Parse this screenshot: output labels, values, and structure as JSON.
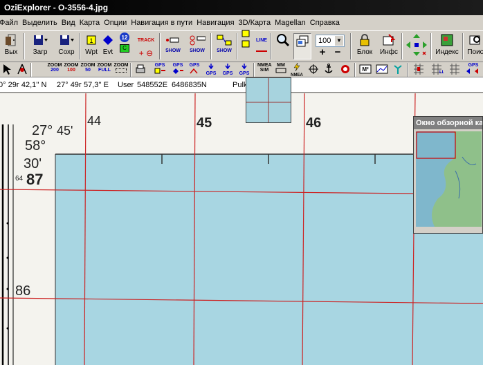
{
  "window": {
    "title": "OziExplorer - O-3556-4.jpg"
  },
  "menu": [
    "Файл",
    "Выделить",
    "Вид",
    "Карта",
    "Опции",
    "Навигация в пути",
    "Навигация",
    "3D/Карта",
    "Magellan",
    "Справка"
  ],
  "toolbar": {
    "exit": "Вых",
    "load": "Загр",
    "save": "Сохр",
    "wpt": "Wpt",
    "evt": "Evt",
    "track": "TRACK",
    "route_num": "12",
    "show1": "SHOW",
    "show2": "SHOW",
    "show3": "SHOW",
    "line": "LINE",
    "zoom_value": "100",
    "block": "Блок",
    "info": "Инфс",
    "index": "Индекс",
    "search": "Поис"
  },
  "toolbar2": {
    "zoom200": "200",
    "zoom100": "100",
    "zoom50": "50",
    "zoomfull": "FULL",
    "zoom_label": "ZOOM",
    "gps": "GPS",
    "nmea_sim": "SIM",
    "nmea": "NMEA",
    "mm": "MM",
    "mm_nmea": "NMEA"
  },
  "status": {
    "lat": "0° 29г 42,1'' N",
    "lon": "27° 49г 57,3'' E",
    "grid_label": "User",
    "easting": "548552E",
    "northing": "6486835N",
    "datum": "Pulk"
  },
  "map": {
    "lat_deg": "27°",
    "lat_min": "45'",
    "lat_top": "58°",
    "lat_30": "30'",
    "grid_64": "64",
    "grid_87": "87",
    "grid_86": "86",
    "col_44": "44",
    "col_45": "45",
    "col_46": "46",
    "water_color": "#a8d6e2",
    "paper_color": "#f4f3ee",
    "grid_color": "#cc2222"
  },
  "overview": {
    "title": "Окно обзорной карты"
  }
}
